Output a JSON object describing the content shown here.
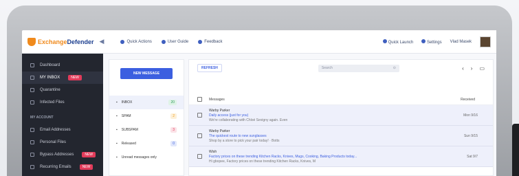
{
  "topbar": {
    "logo_text_a": "Exchange",
    "logo_text_b": "Defender",
    "collapse_glyph": "◀",
    "nav": [
      "Quick Actions",
      "User Guide",
      "Feedback"
    ],
    "right": [
      "Quick Launch",
      "Settings",
      "Vlad Masek"
    ]
  },
  "sidebar": {
    "items": [
      {
        "label": "Dashboard",
        "badge": ""
      },
      {
        "label": "MY INBOX",
        "badge": "NEW"
      },
      {
        "label": "Quarantine",
        "badge": ""
      },
      {
        "label": "Infected Files",
        "badge": ""
      }
    ],
    "section": "MY ACCOUNT",
    "account_items": [
      {
        "label": "Email Addresses",
        "badge": ""
      },
      {
        "label": "Personal Files",
        "badge": ""
      },
      {
        "label": "Bypass Addresses",
        "badge": "NEW"
      },
      {
        "label": "Recurring Emails",
        "badge": "NEW"
      }
    ]
  },
  "folders": {
    "new_message": "NEW MESSAGE",
    "items": [
      {
        "label": "INBOX",
        "count": "20",
        "color": "#2e9b5a"
      },
      {
        "label": "SPAM",
        "count": "2",
        "color": "#f0a020"
      },
      {
        "label": "SUBSPAM",
        "count": "3",
        "color": "#e23b5a"
      },
      {
        "label": "Released",
        "count": "0",
        "color": "#3c5fe0"
      },
      {
        "label": "Unread messages only",
        "count": "",
        "color": ""
      }
    ]
  },
  "mail": {
    "refresh": "REFRESH",
    "search_placeholder": "Search",
    "nav_prev": "‹",
    "nav_next": "›",
    "header_messages": "Messages",
    "header_received": "Received",
    "rows": [
      {
        "from": "Warby Parker",
        "subject": "Daily access (just for you)",
        "preview": "We're collaborating with Chloé Sevigny again. Even",
        "date": "Mon 9/16"
      },
      {
        "from": "Warby Parker",
        "subject": "The quickest route to new sunglasses",
        "preview": "Shop by a store to pick your pair today! · Botts",
        "date": "Sun 9/15"
      },
      {
        "from": "Wish",
        "subject": "Factory prices on these trending Kitchen Racks, Knives, Mugs, Cooking, Baking Products today...",
        "preview": "Hi gbopee, Factory prices on these trending Kitchen Racks, Knives, M",
        "date": "Sat 9/7"
      }
    ]
  }
}
